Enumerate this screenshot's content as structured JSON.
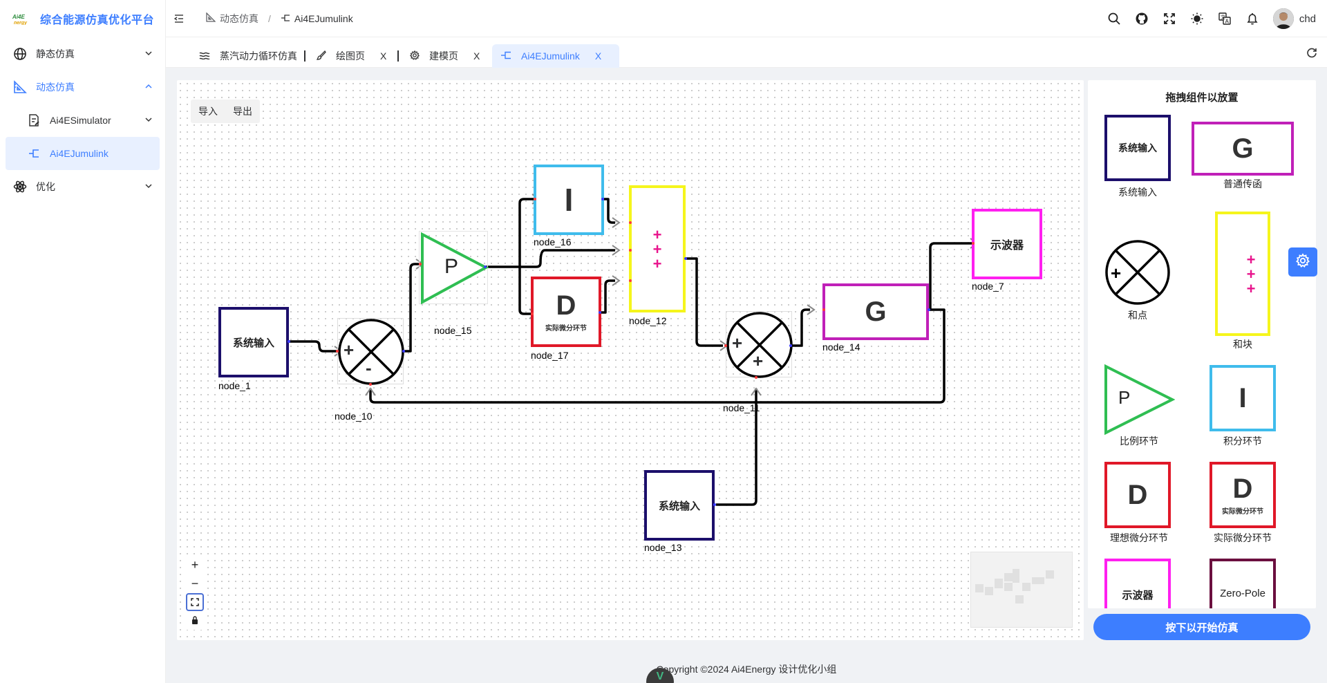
{
  "brand": {
    "logo_text": "Ai4Energy",
    "title": "综合能源仿真优化平台"
  },
  "sidebar": {
    "items": [
      {
        "label": "静态仿真",
        "icon": "globe-icon"
      },
      {
        "label": "动态仿真",
        "icon": "ruler-triangle-icon"
      },
      {
        "label": "Ai4ESimulator",
        "icon": "document-edit-icon"
      },
      {
        "label": "Ai4EJumulink",
        "icon": "link-bracket-icon"
      },
      {
        "label": "优化",
        "icon": "atom-icon"
      }
    ]
  },
  "header": {
    "breadcrumb": [
      "动态仿真",
      "Ai4EJumulink"
    ],
    "username": "chd"
  },
  "tabs": [
    {
      "label": "蒸汽动力循环仿真",
      "icon": "waves-icon"
    },
    {
      "label": "绘图页",
      "icon": "brush-icon",
      "close": "X"
    },
    {
      "label": "建模页",
      "icon": "gear-icon",
      "close": "X"
    },
    {
      "label": "Ai4EJumulink",
      "icon": "link-bracket-icon",
      "close": "X"
    }
  ],
  "toolbar": {
    "import_label": "导入",
    "export_label": "导出"
  },
  "zoom": {
    "in": "+",
    "out": "−"
  },
  "blocks": {
    "input_text": "系统输入",
    "gain_text": "P",
    "integral_text": "I",
    "derivative_text": "D",
    "derivative_sub": "实际微分环节",
    "transfer_text": "G",
    "scope_text": "示波器",
    "plus": "+",
    "minus": "-"
  },
  "nodes": {
    "node_1": "node_1",
    "node_10": "node_10",
    "node_15": "node_15",
    "node_16": "node_16",
    "node_17": "node_17",
    "node_12": "node_12",
    "node_11": "node_11",
    "node_14": "node_14",
    "node_7": "node_7",
    "node_13": "node_13"
  },
  "palette": {
    "title": "拖拽组件以放置",
    "items": [
      {
        "caption": "系统输入",
        "text": "系统输入"
      },
      {
        "caption": "普通传函",
        "text": "G"
      },
      {
        "caption": "和点"
      },
      {
        "caption": "和块"
      },
      {
        "caption": "比例环节",
        "text": "P"
      },
      {
        "caption": "积分环节",
        "text": "I"
      },
      {
        "caption": "理想微分环节",
        "text": "D"
      },
      {
        "caption": "实际微分环节",
        "text": "D",
        "sub": "实际微分环节"
      },
      {
        "text": "示波器"
      },
      {
        "text": "Zero-Pole"
      }
    ]
  },
  "start_button": "按下以开始仿真",
  "footer": {
    "copyright": "Copyright ©2024 Ai4Energy 设计优化小组",
    "logo_text": "V"
  },
  "colors": {
    "accent": "#3d7eff",
    "input": "#1c0f6b",
    "transfer": "#c020b8",
    "integral": "#3fbcec",
    "derivative": "#e01828",
    "gain": "#2fbe52",
    "sum_block": "#f5f51c",
    "scope": "#ff1ff0",
    "zeropole": "#6b0f3f"
  }
}
